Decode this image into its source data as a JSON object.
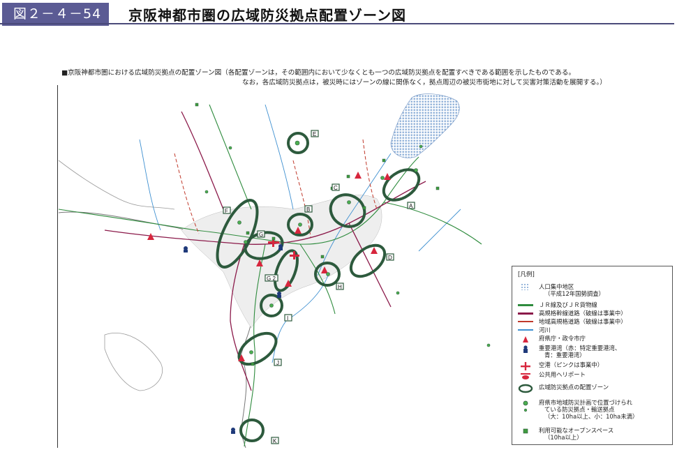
{
  "header": {
    "figure_number": "図２－４－54",
    "title": "京阪神都市圏の広域防災拠点配置ゾーン図"
  },
  "notes": {
    "line1": "■京阪神都市圏における広域防災拠点の配置ゾーン図（各配置ゾーンは，その範囲内において少なくとも一つの広域防災拠点を配置すべきである範囲を示したものである。",
    "line2": "なお，各広域防災拠点は，被災時にはゾーンの線に関係なく，拠点周辺の被災市街地に対して災害対策活動を展開する。）"
  },
  "zones": [
    {
      "label": "E"
    },
    {
      "label": "C"
    },
    {
      "label": "A"
    },
    {
      "label": "F"
    },
    {
      "label": "B"
    },
    {
      "label": "G"
    },
    {
      "label": "G 2"
    },
    {
      "label": "D"
    },
    {
      "label": "H"
    },
    {
      "label": "I"
    },
    {
      "label": "J"
    },
    {
      "label": "K"
    }
  ],
  "legend": {
    "title": "[凡例]",
    "items": [
      {
        "name": "dense-area",
        "line1": "人口集中地区",
        "line2": "（平成12年国勢調査）"
      },
      {
        "name": "jr-line",
        "line1": "ＪＲ線及びＪＲ貨物線",
        "line2": ""
      },
      {
        "name": "highway",
        "line1": "高規格幹線道路（破線は事業中）",
        "line2": ""
      },
      {
        "name": "regional-road",
        "line1": "地域高規格道路（破線は事業中）",
        "line2": ""
      },
      {
        "name": "river",
        "line1": "河川",
        "line2": ""
      },
      {
        "name": "gov-office",
        "line1": "府県庁・政令市庁",
        "line2": ""
      },
      {
        "name": "port",
        "line1": "重要港湾（赤：特定重要港湾、",
        "line2": "青：重要港湾）"
      },
      {
        "name": "airport",
        "line1": "空港（ピンクは事業中）",
        "line2": ""
      },
      {
        "name": "heliport",
        "line1": "公共用ヘリポート",
        "line2": ""
      },
      {
        "name": "zone",
        "line1": "広域防災拠点の配置ゾーン",
        "line2": ""
      },
      {
        "name": "base",
        "line1": "府県市地域防災計画で位置づけられ",
        "line2": "ている防災拠点・輸送拠点",
        "line3": "（大：10ha以上、小：10ha未満）"
      },
      {
        "name": "open-space",
        "line1": "利用可能なオープンスペース",
        "line2": "（10ha以上）"
      }
    ]
  },
  "colors": {
    "figure_label_bg": "#5b5b94",
    "zone": "#2d5a3d",
    "jr_line": "#2e8b3d",
    "highway": "#8b1a4a",
    "regional_road": "#c0392b",
    "river": "#3d8fd0",
    "gov_office": "#d7263d",
    "port": "#1f3a7a",
    "airport": "#d7263d",
    "dense_area": "#8fb0d8",
    "base": "#4caf50",
    "open_space": "#3f9b3f"
  }
}
